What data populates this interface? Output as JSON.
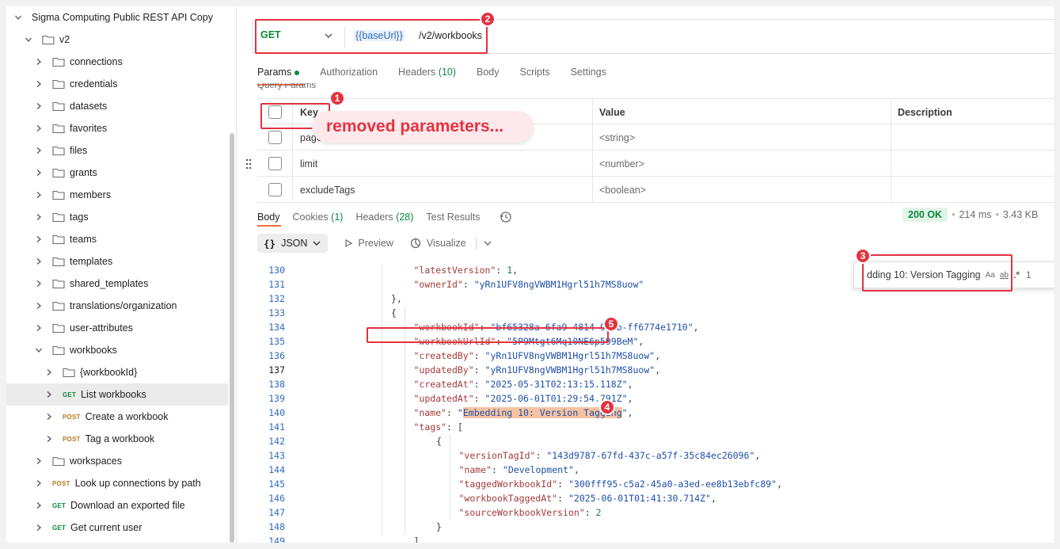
{
  "sidebar": {
    "items": [
      {
        "label": "Sigma Computing Public REST API Copy",
        "type": "collection",
        "expanded": true,
        "method": ""
      },
      {
        "label": "v2",
        "type": "folder",
        "expanded": true,
        "method": ""
      },
      {
        "label": "connections",
        "type": "folder",
        "expanded": false,
        "method": ""
      },
      {
        "label": "credentials",
        "type": "folder",
        "expanded": false,
        "method": ""
      },
      {
        "label": "datasets",
        "type": "folder",
        "expanded": false,
        "method": ""
      },
      {
        "label": "favorites",
        "type": "folder",
        "expanded": false,
        "method": ""
      },
      {
        "label": "files",
        "type": "folder",
        "expanded": false,
        "method": ""
      },
      {
        "label": "grants",
        "type": "folder",
        "expanded": false,
        "method": ""
      },
      {
        "label": "members",
        "type": "folder",
        "expanded": false,
        "method": ""
      },
      {
        "label": "tags",
        "type": "folder",
        "expanded": false,
        "method": ""
      },
      {
        "label": "teams",
        "type": "folder",
        "expanded": false,
        "method": ""
      },
      {
        "label": "templates",
        "type": "folder",
        "expanded": false,
        "method": ""
      },
      {
        "label": "shared_templates",
        "type": "folder",
        "expanded": false,
        "method": ""
      },
      {
        "label": "translations/organization",
        "type": "folder",
        "expanded": false,
        "method": ""
      },
      {
        "label": "user-attributes",
        "type": "folder",
        "expanded": false,
        "method": ""
      },
      {
        "label": "workbooks",
        "type": "folder",
        "expanded": true,
        "method": ""
      },
      {
        "label": "{workbookId}",
        "type": "folder",
        "expanded": false,
        "method": ""
      },
      {
        "label": "List workbooks",
        "type": "request",
        "expanded": false,
        "method": "GET"
      },
      {
        "label": "Create a workbook",
        "type": "request",
        "expanded": false,
        "method": "POST"
      },
      {
        "label": "Tag a workbook",
        "type": "request",
        "expanded": false,
        "method": "POST"
      },
      {
        "label": "workspaces",
        "type": "folder",
        "expanded": false,
        "method": ""
      },
      {
        "label": "Look up connections by path",
        "type": "request",
        "expanded": false,
        "method": "POST"
      },
      {
        "label": "Download an exported file",
        "type": "request",
        "expanded": false,
        "method": "GET"
      },
      {
        "label": "Get current user",
        "type": "request",
        "expanded": false,
        "method": "GET"
      }
    ]
  },
  "request": {
    "method": "GET",
    "url_variable": "{{baseUrl}}",
    "url_path": "/v2/workbooks"
  },
  "request_tabs": {
    "params": "Params",
    "authorization": "Authorization",
    "headers": "Headers",
    "headers_count": "(10)",
    "body": "Body",
    "scripts": "Scripts",
    "settings": "Settings"
  },
  "query_params": {
    "section_label": "Query Params",
    "columns": {
      "key": "Key",
      "value": "Value",
      "description": "Description"
    },
    "rows": [
      {
        "key": "page",
        "value": "<string>",
        "description": ""
      },
      {
        "key": "limit",
        "value": "<number>",
        "description": ""
      },
      {
        "key": "excludeTags",
        "value": "<boolean>",
        "description": ""
      }
    ]
  },
  "callout": {
    "text": "removed parameters..."
  },
  "annotations": {
    "n1": "1",
    "n2": "2",
    "n3": "3",
    "n4": "4",
    "n5": "5"
  },
  "response_tabs": {
    "body": "Body",
    "cookies": "Cookies",
    "cookies_count": "(1)",
    "headers": "Headers",
    "headers_count": "(28)",
    "test_results": "Test Results"
  },
  "response_status": {
    "code": "200 OK",
    "time": "214 ms",
    "size": "3.43 KB"
  },
  "body_toolbar": {
    "format": "JSON",
    "preview": "Preview",
    "visualize": "Visualize"
  },
  "find": {
    "query": "dding 10: Version Tagging",
    "match_case": "Aa",
    "whole_word": "ab",
    "regex": ".*",
    "count": "1"
  },
  "code": {
    "current_line": 137,
    "lines": [
      {
        "n": "130",
        "i": 5,
        "t": "\"latestVersion\": 1,"
      },
      {
        "n": "131",
        "i": 5,
        "t": "\"ownerId\": \"yRn1UFV8ngVWBM1Hgrl51h7MS8uow\""
      },
      {
        "n": "132",
        "i": 4,
        "t": "},"
      },
      {
        "n": "133",
        "i": 4,
        "t": "{"
      },
      {
        "n": "134",
        "i": 5,
        "t": "\"workbookId\": \"bf65328a-6fa9-4814-91fb-ff6774e1710\","
      },
      {
        "n": "135",
        "i": 5,
        "t": "\"workbookUrlId\": \"5P9Mtgt6Mq10NE6p599BeM\","
      },
      {
        "n": "136",
        "i": 5,
        "t": "\"createdBy\": \"yRn1UFV8ngVWBM1Hgrl51h7MS8uow\","
      },
      {
        "n": "137",
        "i": 5,
        "t": "\"updatedBy\": \"yRn1UFV8ngVWBM1Hgrl51h7MS8uow\","
      },
      {
        "n": "138",
        "i": 5,
        "t": "\"createdAt\": \"2025-05-31T02:13:15.118Z\","
      },
      {
        "n": "139",
        "i": 5,
        "t": "\"updatedAt\": \"2025-06-01T01:29:54.791Z\","
      },
      {
        "n": "140",
        "i": 5,
        "t": "\"name\": \"Embedding 10: Version Tagging\","
      },
      {
        "n": "141",
        "i": 5,
        "t": "\"tags\": ["
      },
      {
        "n": "142",
        "i": 6,
        "t": "{"
      },
      {
        "n": "143",
        "i": 7,
        "t": "\"versionTagId\": \"143d9787-67fd-437c-a57f-35c84ec26096\","
      },
      {
        "n": "144",
        "i": 7,
        "t": "\"name\": \"Development\","
      },
      {
        "n": "145",
        "i": 7,
        "t": "\"taggedWorkbookId\": \"300fff95-c5a2-45a0-a3ed-ee8b13ebfc89\","
      },
      {
        "n": "146",
        "i": 7,
        "t": "\"workbookTaggedAt\": \"2025-06-01T01:41:30.714Z\","
      },
      {
        "n": "147",
        "i": 7,
        "t": "\"sourceWorkbookVersion\": 2"
      },
      {
        "n": "148",
        "i": 6,
        "t": "}"
      },
      {
        "n": "149",
        "i": 5,
        "t": "],"
      }
    ],
    "highlight": "Embedding 10: Version Tagging"
  },
  "colors": {
    "get": "#0c8a3e",
    "post": "#b7791f",
    "annotation": "#e5323f",
    "accent_tab": "#f26b3a"
  }
}
